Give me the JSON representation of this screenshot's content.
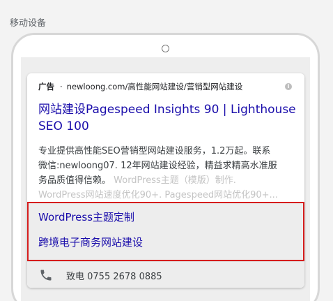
{
  "section": {
    "label": "移动设备"
  },
  "ad": {
    "badge": "广告",
    "separator": "·",
    "display_url": "newloong.com/高性能网站建设/营销型网站建设",
    "info_icon_glyph": "i",
    "title_line1": "网站建设Pagespeed Insights 90 | Lighthouse",
    "title_line2": "SEO 100",
    "description_line1": "专业提供高性能SEO营销型网站建设服务，1.2万起。联系",
    "description_line2": "微信:newloong07. 12年网站建设经验，精益求精高水准服",
    "description_line3_main": "务品质值得信赖。",
    "description_line3_faded": " WordPress主题（模版）制作.",
    "description_line4_faded": "WordPress网站速度优化90+. Pagespeed网站优化90+...",
    "sitelinks": [
      {
        "label": "WordPress主题定制"
      },
      {
        "label": "跨境电子商务网站建设"
      }
    ],
    "call": {
      "icon": "phone-icon",
      "text": "致电 0755 2678 0885"
    }
  },
  "colors": {
    "title_link": "#1a0dab",
    "highlight_border": "#d61d1d",
    "text": "#3c4043",
    "faded_text": "#c4c4c4"
  }
}
